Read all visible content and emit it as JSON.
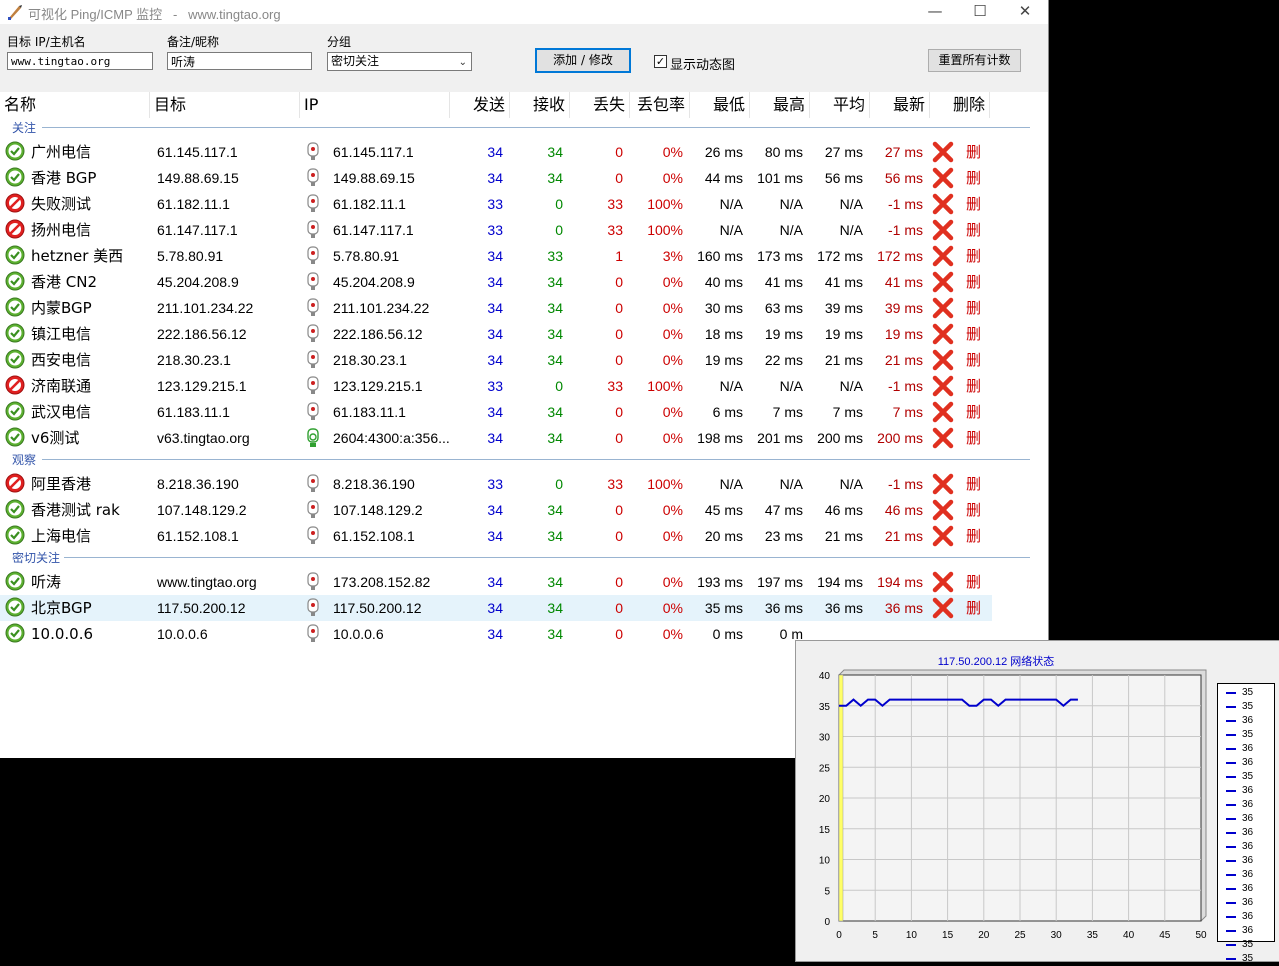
{
  "window": {
    "title": "可视化 Ping/ICMP 监控   -   www.tingtao.org",
    "minimize_glyph": "—",
    "maximize_glyph": "☐",
    "close_glyph": "✕"
  },
  "toolbar": {
    "target_label": "目标 IP/主机名",
    "target_value": "www.tingtao.org",
    "note_label": "备注/昵称",
    "note_value": "听涛",
    "group_label": "分组",
    "group_value": "密切关注",
    "add_button": "添加 / 修改",
    "show_chart_label": "显示动态图",
    "show_chart_checked": true,
    "reset_button": "重置所有计数"
  },
  "columns": [
    "名称",
    "目标",
    "IP",
    "发送",
    "接收",
    "丢失",
    "丢包率",
    "最低",
    "最高",
    "平均",
    "最新",
    "删除"
  ],
  "delete_text": "删",
  "groups": [
    {
      "name": "关注",
      "rows": [
        {
          "status": "ok",
          "name": "广州电信",
          "target": "61.145.117.1",
          "ip": "61.145.117.1",
          "ipv6": false,
          "sent": "34",
          "recv": "34",
          "lost": "0",
          "loss": "0%",
          "min": "26 ms",
          "max": "80 ms",
          "avg": "27 ms",
          "last": "27 ms"
        },
        {
          "status": "ok",
          "name": "香港 BGP",
          "target": "149.88.69.15",
          "ip": "149.88.69.15",
          "ipv6": false,
          "sent": "34",
          "recv": "34",
          "lost": "0",
          "loss": "0%",
          "min": "44 ms",
          "max": "101 ms",
          "avg": "56 ms",
          "last": "56 ms"
        },
        {
          "status": "fail",
          "name": "失败测试",
          "target": "61.182.11.1",
          "ip": "61.182.11.1",
          "ipv6": false,
          "sent": "33",
          "recv": "0",
          "lost": "33",
          "loss": "100%",
          "min": "N/A",
          "max": "N/A",
          "avg": "N/A",
          "last": "-1 ms"
        },
        {
          "status": "fail",
          "name": "扬州电信",
          "target": "61.147.117.1",
          "ip": "61.147.117.1",
          "ipv6": false,
          "sent": "33",
          "recv": "0",
          "lost": "33",
          "loss": "100%",
          "min": "N/A",
          "max": "N/A",
          "avg": "N/A",
          "last": "-1 ms"
        },
        {
          "status": "ok",
          "name": "hetzner 美西",
          "target": "5.78.80.91",
          "ip": "5.78.80.91",
          "ipv6": false,
          "sent": "34",
          "recv": "33",
          "lost": "1",
          "loss": "3%",
          "min": "160 ms",
          "max": "173 ms",
          "avg": "172 ms",
          "last": "172 ms"
        },
        {
          "status": "ok",
          "name": "香港 CN2",
          "target": "45.204.208.9",
          "ip": "45.204.208.9",
          "ipv6": false,
          "sent": "34",
          "recv": "34",
          "lost": "0",
          "loss": "0%",
          "min": "40 ms",
          "max": "41 ms",
          "avg": "41 ms",
          "last": "41 ms"
        },
        {
          "status": "ok",
          "name": "内蒙BGP",
          "target": "211.101.234.22",
          "ip": "211.101.234.22",
          "ipv6": false,
          "sent": "34",
          "recv": "34",
          "lost": "0",
          "loss": "0%",
          "min": "30 ms",
          "max": "63 ms",
          "avg": "39 ms",
          "last": "39 ms"
        },
        {
          "status": "ok",
          "name": "镇江电信",
          "target": "222.186.56.12",
          "ip": "222.186.56.12",
          "ipv6": false,
          "sent": "34",
          "recv": "34",
          "lost": "0",
          "loss": "0%",
          "min": "18 ms",
          "max": "19 ms",
          "avg": "19 ms",
          "last": "19 ms"
        },
        {
          "status": "ok",
          "name": "西安电信",
          "target": "218.30.23.1",
          "ip": "218.30.23.1",
          "ipv6": false,
          "sent": "34",
          "recv": "34",
          "lost": "0",
          "loss": "0%",
          "min": "19 ms",
          "max": "22 ms",
          "avg": "21 ms",
          "last": "21 ms"
        },
        {
          "status": "fail",
          "name": "济南联通",
          "target": "123.129.215.1",
          "ip": "123.129.215.1",
          "ipv6": false,
          "sent": "33",
          "recv": "0",
          "lost": "33",
          "loss": "100%",
          "min": "N/A",
          "max": "N/A",
          "avg": "N/A",
          "last": "-1 ms"
        },
        {
          "status": "ok",
          "name": "武汉电信",
          "target": "61.183.11.1",
          "ip": "61.183.11.1",
          "ipv6": false,
          "sent": "34",
          "recv": "34",
          "lost": "0",
          "loss": "0%",
          "min": "6 ms",
          "max": "7 ms",
          "avg": "7 ms",
          "last": "7 ms"
        },
        {
          "status": "ok",
          "name": "v6测试",
          "target": "v63.tingtao.org",
          "ip": "2604:4300:a:356...",
          "ipv6": true,
          "sent": "34",
          "recv": "34",
          "lost": "0",
          "loss": "0%",
          "min": "198 ms",
          "max": "201 ms",
          "avg": "200 ms",
          "last": "200 ms"
        }
      ]
    },
    {
      "name": "观察",
      "rows": [
        {
          "status": "fail",
          "name": "阿里香港",
          "target": "8.218.36.190",
          "ip": "8.218.36.190",
          "ipv6": false,
          "sent": "33",
          "recv": "0",
          "lost": "33",
          "loss": "100%",
          "min": "N/A",
          "max": "N/A",
          "avg": "N/A",
          "last": "-1 ms"
        },
        {
          "status": "ok",
          "name": "香港测试 rak",
          "target": "107.148.129.2",
          "ip": "107.148.129.2",
          "ipv6": false,
          "sent": "34",
          "recv": "34",
          "lost": "0",
          "loss": "0%",
          "min": "45 ms",
          "max": "47 ms",
          "avg": "46 ms",
          "last": "46 ms"
        },
        {
          "status": "ok",
          "name": "上海电信",
          "target": "61.152.108.1",
          "ip": "61.152.108.1",
          "ipv6": false,
          "sent": "34",
          "recv": "34",
          "lost": "0",
          "loss": "0%",
          "min": "20 ms",
          "max": "23 ms",
          "avg": "21 ms",
          "last": "21 ms"
        }
      ]
    },
    {
      "name": "密切关注",
      "rows": [
        {
          "status": "ok",
          "name": "听涛",
          "target": "www.tingtao.org",
          "ip": "173.208.152.82",
          "ipv6": false,
          "sent": "34",
          "recv": "34",
          "lost": "0",
          "loss": "0%",
          "min": "193 ms",
          "max": "197 ms",
          "avg": "194 ms",
          "last": "194 ms"
        },
        {
          "status": "ok",
          "name": "北京BGP",
          "target": "117.50.200.12",
          "ip": "117.50.200.12",
          "ipv6": false,
          "sent": "34",
          "recv": "34",
          "lost": "0",
          "loss": "0%",
          "min": "35 ms",
          "max": "36 ms",
          "avg": "36 ms",
          "last": "36 ms",
          "selected": true
        },
        {
          "status": "ok",
          "name": "10.0.0.6",
          "target": "10.0.0.6",
          "ip": "10.0.0.6",
          "ipv6": false,
          "sent": "34",
          "recv": "34",
          "lost": "0",
          "loss": "0%",
          "min": "0 ms",
          "max": "0 m",
          "avg": "",
          "last": "",
          "partial": true
        }
      ]
    }
  ],
  "chart_data": {
    "type": "line",
    "title": "117.50.200.12 网络状态",
    "xlim": [
      0,
      50
    ],
    "ylim": [
      0,
      40
    ],
    "xticks": [
      0,
      5,
      10,
      15,
      20,
      25,
      30,
      35,
      40,
      45,
      50
    ],
    "yticks": [
      0,
      5,
      10,
      15,
      20,
      25,
      30,
      35,
      40
    ],
    "grid": true,
    "legend_position": "right",
    "series": [
      {
        "values": [
          35,
          35,
          36,
          35,
          36,
          36,
          35,
          36,
          36,
          36,
          36,
          36,
          36,
          36,
          36,
          36,
          36,
          36,
          35,
          35,
          36,
          36,
          35,
          36,
          36,
          36,
          36,
          36,
          36,
          36,
          36,
          35,
          36,
          36
        ]
      }
    ],
    "legend_entries": [
      "35",
      "35",
      "36",
      "35",
      "36",
      "36",
      "35",
      "36",
      "36",
      "36",
      "36",
      "36",
      "36",
      "36",
      "36",
      "36",
      "36",
      "36",
      "35",
      "35"
    ],
    "colors": {
      "line": "#0000cc",
      "plot_bg": "#f4f4f4",
      "marker_band": "#ffff66"
    }
  },
  "colors": {
    "sent": "#0000cc",
    "recv": "#008800",
    "lost": "#cc0000",
    "selected_row": "#e5f3fb"
  }
}
